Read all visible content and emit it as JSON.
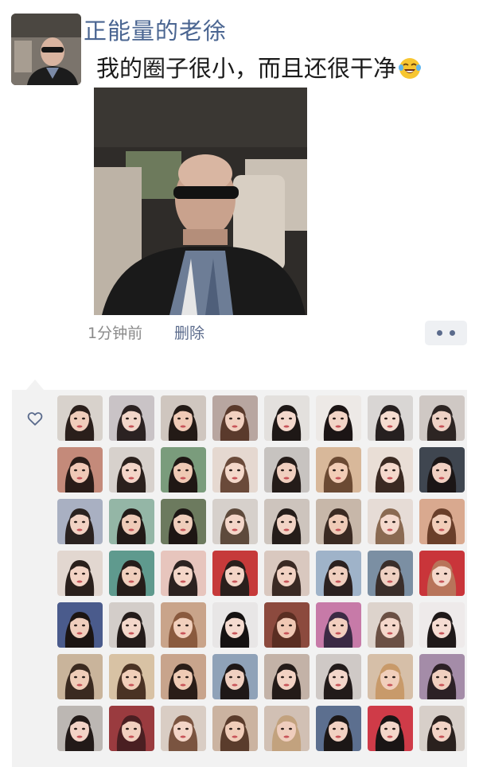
{
  "post": {
    "username": "正能量的老徐",
    "text": "我的圈子很小，而且还很干净",
    "emoji": "laughing-tears-emoji",
    "time": "1分钟前",
    "delete_label": "删除"
  },
  "likes": {
    "icon": "heart-outline-icon",
    "avatars": [
      {
        "bg": "#d8d2cc",
        "skin": "#f0cdbb",
        "hair": "#2a1f1b"
      },
      {
        "bg": "#c9c3c6",
        "skin": "#f2d6ca",
        "hair": "#2b2222"
      },
      {
        "bg": "#cfc6bf",
        "skin": "#efcab6",
        "hair": "#231a16"
      },
      {
        "bg": "#b8a6a0",
        "skin": "#f1d0c0",
        "hair": "#5a3a2c"
      },
      {
        "bg": "#e3e0dd",
        "skin": "#f3d8cc",
        "hair": "#1e1816"
      },
      {
        "bg": "#ede9e6",
        "skin": "#f2d4c6",
        "hair": "#1c1515"
      },
      {
        "bg": "#d9d6d4",
        "skin": "#f5dcd0",
        "hair": "#262020"
      },
      {
        "bg": "#cfc8c4",
        "skin": "#eed2c5",
        "hair": "#2d2523"
      },
      {
        "bg": "#c48a7a",
        "skin": "#f0c8b6",
        "hair": "#2a1c18"
      },
      {
        "bg": "#d7d1cc",
        "skin": "#f3d5c8",
        "hair": "#2b211d"
      },
      {
        "bg": "#7a9c7c",
        "skin": "#efc9b4",
        "hair": "#1f1714"
      },
      {
        "bg": "#e5d8d0",
        "skin": "#f4d8ca",
        "hair": "#6a4a3a"
      },
      {
        "bg": "#c7c3c0",
        "skin": "#f0cfbf",
        "hair": "#241c19"
      },
      {
        "bg": "#d8b89a",
        "skin": "#f2cdb6",
        "hair": "#6b4a33"
      },
      {
        "bg": "#e9ded6",
        "skin": "#f5d9cc",
        "hair": "#3b2a22"
      },
      {
        "bg": "#3f4650",
        "skin": "#f0d0c2",
        "hair": "#1b1616"
      },
      {
        "bg": "#a9b0c2",
        "skin": "#f1d2c4",
        "hair": "#2a2220"
      },
      {
        "bg": "#94b6a6",
        "skin": "#eecbb8",
        "hair": "#221a17"
      },
      {
        "bg": "#6c7a5e",
        "skin": "#efcdbb",
        "hair": "#1d1614"
      },
      {
        "bg": "#d6d0cb",
        "skin": "#f3d6c9",
        "hair": "#5e4a3c"
      },
      {
        "bg": "#cdc4bd",
        "skin": "#f1d3c5",
        "hair": "#251d1a"
      },
      {
        "bg": "#c7b7a9",
        "skin": "#efcbb7",
        "hair": "#3a2a22"
      },
      {
        "bg": "#e6dcd6",
        "skin": "#f4d9cd",
        "hair": "#8a6a52"
      },
      {
        "bg": "#d9a98f",
        "skin": "#f1cdb9",
        "hair": "#6a3f2a"
      },
      {
        "bg": "#e2d7d0",
        "skin": "#f3d4c5",
        "hair": "#2a201c"
      },
      {
        "bg": "#5f9a8e",
        "skin": "#f0cfbd",
        "hair": "#261d1a"
      },
      {
        "bg": "#e7c5bd",
        "skin": "#f4d6c8",
        "hair": "#2c2220"
      },
      {
        "bg": "#c63a3a",
        "skin": "#f3d4c6",
        "hair": "#2a1f1c"
      },
      {
        "bg": "#d9c8bf",
        "skin": "#f2d2c3",
        "hair": "#3a2a24"
      },
      {
        "bg": "#9fb3c9",
        "skin": "#f0cfbf",
        "hair": "#2b2120"
      },
      {
        "bg": "#7b8fa3",
        "skin": "#eed0c2",
        "hair": "#3a2e2a"
      },
      {
        "bg": "#c9353a",
        "skin": "#f4d8cb",
        "hair": "#b8745a"
      },
      {
        "bg": "#4a5b8c",
        "skin": "#f0cebd",
        "hair": "#1c1513"
      },
      {
        "bg": "#d3cdc9",
        "skin": "#f3d7ca",
        "hair": "#241c1a"
      },
      {
        "bg": "#c9a48a",
        "skin": "#f2d0bd",
        "hair": "#8a5a3e"
      },
      {
        "bg": "#e8e6e6",
        "skin": "#f5dbd0",
        "hair": "#151212"
      },
      {
        "bg": "#8c4a3e",
        "skin": "#f0c8b4",
        "hair": "#5a2e22"
      },
      {
        "bg": "#c77aa8",
        "skin": "#f2cfbf",
        "hair": "#3b2a44"
      },
      {
        "bg": "#ddd3cc",
        "skin": "#f4d7ca",
        "hair": "#6b5044"
      },
      {
        "bg": "#eeeaea",
        "skin": "#f5dcd2",
        "hair": "#1f1919"
      },
      {
        "bg": "#c9b49b",
        "skin": "#f0cdb8",
        "hair": "#3a2a20"
      },
      {
        "bg": "#d8c2a4",
        "skin": "#f1cfb9",
        "hair": "#4a3324"
      },
      {
        "bg": "#c8a48c",
        "skin": "#efcbb5",
        "hair": "#2a1d18"
      },
      {
        "bg": "#8fa2b8",
        "skin": "#f0d0c1",
        "hair": "#1e1817"
      },
      {
        "bg": "#c3b2a7",
        "skin": "#f2d2c3",
        "hair": "#241b18"
      },
      {
        "bg": "#cfc9c6",
        "skin": "#f3d6ca",
        "hair": "#221b1a"
      },
      {
        "bg": "#d6bfa8",
        "skin": "#f1cfbc",
        "hair": "#c89a6a"
      },
      {
        "bg": "#a48ca8",
        "skin": "#f0cfc0",
        "hair": "#2c2126"
      },
      {
        "bg": "#bcb7b3",
        "skin": "#f2d3c6",
        "hair": "#221a18"
      },
      {
        "bg": "#9a3b3f",
        "skin": "#f1cfbf",
        "hair": "#4a1f22"
      },
      {
        "bg": "#d9cdc4",
        "skin": "#f3d5c7",
        "hair": "#7a5440"
      },
      {
        "bg": "#cbb3a0",
        "skin": "#f0cdb9",
        "hair": "#5a3c2c"
      },
      {
        "bg": "#d1c0b4",
        "skin": "#efcdbd",
        "hair": "#c2a27e"
      },
      {
        "bg": "#5c6f8f",
        "skin": "#f1d1c2",
        "hair": "#1c1716"
      },
      {
        "bg": "#cf3b48",
        "skin": "#f3d6c9",
        "hair": "#1a1515"
      },
      {
        "bg": "#d7cfc9",
        "skin": "#f2d3c5",
        "hair": "#2a211e"
      }
    ]
  }
}
